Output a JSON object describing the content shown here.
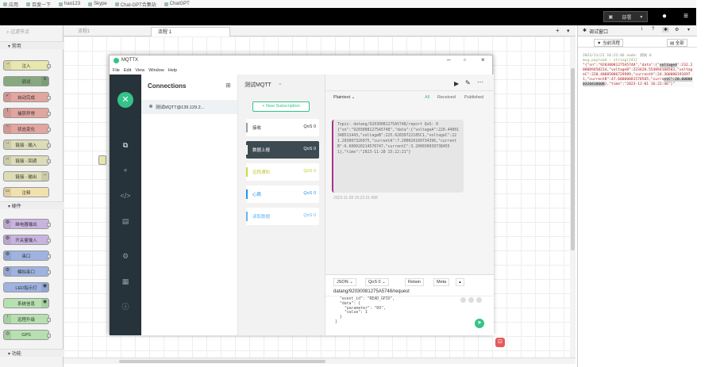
{
  "browser": {
    "bookmarks": [
      "应用",
      "百度一下",
      "hao123",
      "Skype",
      "Chat-GPT合集站",
      "ChatGPT"
    ]
  },
  "header": {
    "deploy_label": "部署",
    "user_icon": "user-icon",
    "menu_icon": "menu-icon"
  },
  "palette": {
    "search_placeholder": "过滤节点",
    "categories": {
      "common": "常用",
      "hardware": "硬件",
      "function": "功能"
    },
    "common_nodes": [
      "注入",
      "调试",
      "自动完成",
      "捕获异常",
      "状态变化",
      "链接 - 输入",
      "链接 - 回调",
      "链接 - 输出",
      "注释"
    ],
    "hardware_nodes": [
      "继电器输出",
      "开关量输入",
      "串口",
      "模拟串口",
      "LED指示灯",
      "系统信息",
      "远程升级",
      "GPS"
    ]
  },
  "workspace": {
    "tabs": [
      "流程1",
      "流程 1"
    ],
    "add_tab": "+",
    "more": "▾"
  },
  "debug": {
    "tab_label": "调试窗口",
    "filter_label": "当前流程",
    "clear_label": "全部",
    "timestamp": "2023/11/21 16:22:46",
    "node_label": "node: 调试 6",
    "topic": "msg.payload : string[241]",
    "payload_pre": "\"{\"sn\":\"92030081275A5748\",\"data\":{\"",
    "payload_hl1": "voltageA",
    "payload_mid1": "\":232.200089450214,\"voltageB\":",
    "payload_mid2": "223420.554894108583,\"voltageC\":220.400",
    "payload_mid3": "05086729989,\"currentA\":24.30000019169",
    "payload_mid4": "71,\"currentB\":47.60000081578505,\"curre",
    "payload_hl2": "ntC\":20.6000003",
    "payload_hl3": "20410608",
    "payload_post": "},\"time\":\"2023-12-01 16:22:46\"}\""
  },
  "mqttx": {
    "app_title": "MQTTX",
    "menu": [
      "File",
      "Edit",
      "View",
      "Window",
      "Help"
    ],
    "connections_title": "Connections",
    "connection_name": "测试MQTT@139.129.2...",
    "main_title": "测试MQTT",
    "new_subscription": "New Subscription",
    "subscriptions": [
      {
        "name": "接收",
        "qos": "QoS 0",
        "color": "#9e9e9e"
      },
      {
        "name": "数据上报",
        "qos": "QoS 0",
        "color": "#3d4a52"
      },
      {
        "name": "远程通知",
        "qos": "QoS 0",
        "color": "#cddc39"
      },
      {
        "name": "心跳",
        "qos": "QoS 0",
        "color": "#2196f3"
      },
      {
        "name": "读取数据",
        "qos": "QoS 0",
        "color": "#64b5f6"
      }
    ],
    "filter_dropdown": "Plaintext",
    "filter_all": "All",
    "filter_received": "Received",
    "filter_published": "Published",
    "msg_topic": "Topic: datang/92030081275A5748/report   QoS: 0",
    "msg_body": "{\"sn\":\"92030081275A5748\",\"data\":{\"voltageA\":220.44001348511443,\"voltageB\":225.62839722185C1,\"voltageC\":221.203007326975,\"currentA\":7.200020160734396,\"currentB\":6.600020214576747,\"currentC\":3.2000300397384551},\"time\":\"2023-11-28 15:22:21\"}",
    "msg_time": "2023-11-28 15:22:21:458",
    "payload_format": "JSON",
    "qos_select": "QoS 0",
    "retain_label": "Retain",
    "meta_label": "Meta",
    "publish_topic": "datang/92030081275A5748/request",
    "publish_body_lines": [
      "\"event_id\": \"READ_GPIO\",",
      "\"data\": {",
      "\"parameter\": \"DO\",",
      "\"value\": 1",
      "}",
      "}"
    ]
  }
}
